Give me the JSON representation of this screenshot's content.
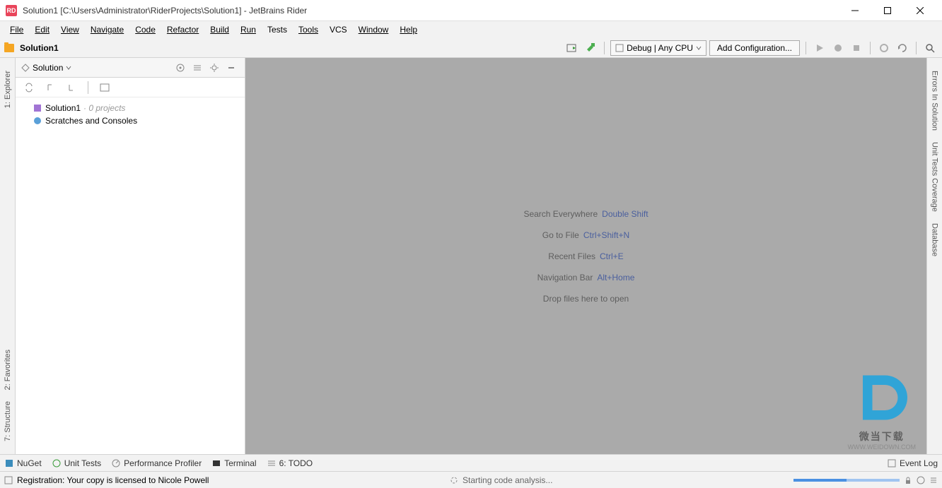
{
  "window": {
    "title": "Solution1 [C:\\Users\\Administrator\\RiderProjects\\Solution1] - JetBrains Rider",
    "icon_label": "RD"
  },
  "menu": {
    "file": "File",
    "edit": "Edit",
    "view": "View",
    "navigate": "Navigate",
    "code": "Code",
    "refactor": "Refactor",
    "build": "Build",
    "run": "Run",
    "tests": "Tests",
    "tools": "Tools",
    "vcs": "VCS",
    "window": "Window",
    "help": "Help"
  },
  "navbar": {
    "breadcrumb": "Solution1",
    "config_label": "Debug | Any CPU",
    "add_config": "Add Configuration..."
  },
  "left_tabs": {
    "explorer": "1: Explorer",
    "favorites": "2: Favorites",
    "structure": "7: Structure"
  },
  "right_tabs": {
    "errors": "Errors In Solution",
    "unit_tests": "Unit Tests Coverage",
    "database": "Database"
  },
  "explorer": {
    "header": "Solution",
    "tree": {
      "solution": "Solution1",
      "solution_meta": "· 0 projects",
      "scratches": "Scratches and Consoles"
    }
  },
  "editor_hints": {
    "search": {
      "label": "Search Everywhere",
      "key": "Double Shift"
    },
    "goto": {
      "label": "Go to File",
      "key": "Ctrl+Shift+N"
    },
    "recent": {
      "label": "Recent Files",
      "key": "Ctrl+E"
    },
    "navbar": {
      "label": "Navigation Bar",
      "key": "Alt+Home"
    },
    "drop": "Drop files here to open"
  },
  "watermark": {
    "text": "微当下载",
    "sub": "WWW.WEIDOWN.COM"
  },
  "bottom_tabs": {
    "nuget": "NuGet",
    "unit_tests": "Unit Tests",
    "profiler": "Performance Profiler",
    "terminal": "Terminal",
    "todo": "6: TODO",
    "event_log": "Event Log"
  },
  "status": {
    "registration": "Registration: Your copy is licensed to Nicole Powell",
    "analysis": "Starting code analysis..."
  }
}
